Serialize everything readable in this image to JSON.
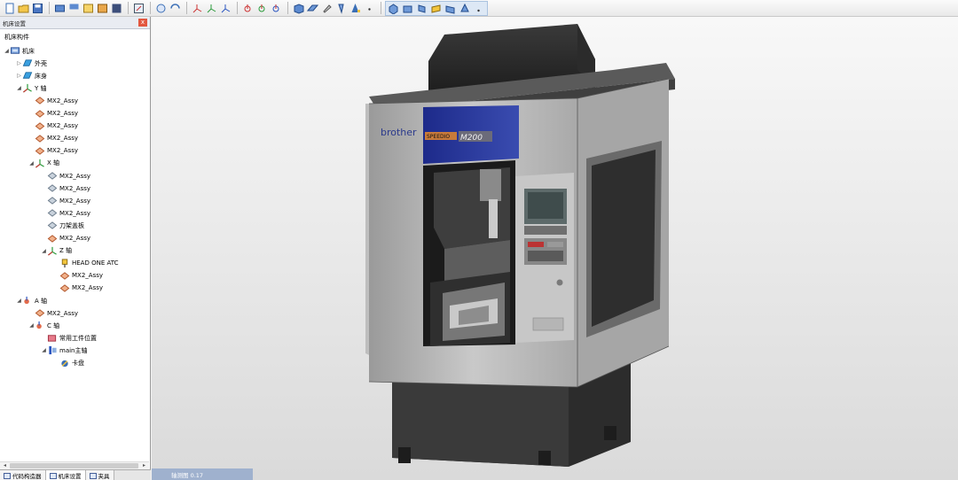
{
  "toolbar": {
    "buttons": [
      {
        "icon": "new-file-icon"
      },
      {
        "icon": "open-folder-icon"
      },
      {
        "icon": "save-icon"
      },
      {
        "sep": true
      },
      {
        "icon": "machine-view-icon"
      },
      {
        "icon": "scale-icon",
        "text": "1.00"
      },
      {
        "icon": "open-project-icon"
      },
      {
        "icon": "export-icon"
      },
      {
        "icon": "script-icon"
      },
      {
        "sep": true
      },
      {
        "icon": "settings-edit-icon"
      },
      {
        "sep": true
      },
      {
        "icon": "rotate-refresh-icon"
      },
      {
        "icon": "sync-icon"
      },
      {
        "sep": true
      },
      {
        "icon": "axis-x-icon"
      },
      {
        "icon": "axis-y-icon"
      },
      {
        "icon": "axis-z-icon"
      },
      {
        "sep": true
      },
      {
        "icon": "axis-rotate-a-icon"
      },
      {
        "icon": "axis-rotate-b-icon"
      },
      {
        "icon": "axis-rotate-c-icon"
      },
      {
        "sep": true
      },
      {
        "icon": "solid-cube-icon"
      },
      {
        "icon": "plane-icon"
      },
      {
        "icon": "paint-icon"
      },
      {
        "icon": "tool-icon"
      },
      {
        "icon": "cone-icon"
      },
      {
        "icon": "dot-menu-icon"
      },
      {
        "sep": true
      }
    ],
    "group_buttons": [
      {
        "icon": "view-iso-icon"
      },
      {
        "icon": "view-front-icon"
      },
      {
        "icon": "view-side-icon"
      },
      {
        "icon": "view-top-icon"
      },
      {
        "icon": "view-bottom-icon"
      },
      {
        "icon": "view-zoom-icon"
      },
      {
        "icon": "view-more-icon"
      }
    ]
  },
  "panel": {
    "title": "机床设置",
    "close_label": "x",
    "tree_header": "机床构件",
    "tree": [
      {
        "label": "机床",
        "depth": 0,
        "icon": "machine-icon",
        "twisty": "◢"
      },
      {
        "label": "外壳",
        "depth": 1,
        "icon": "shell-icon",
        "twisty": "▷"
      },
      {
        "label": "床身",
        "depth": 1,
        "icon": "shell-icon",
        "twisty": "▷"
      },
      {
        "label": "Y 轴",
        "depth": 1,
        "icon": "axis-icon",
        "twisty": "◢"
      },
      {
        "label": "MX2_Assy",
        "depth": 2,
        "icon": "part-orange-icon"
      },
      {
        "label": "MX2_Assy",
        "depth": 2,
        "icon": "part-orange-icon"
      },
      {
        "label": "MX2_Assy",
        "depth": 2,
        "icon": "part-orange-icon"
      },
      {
        "label": "MX2_Assy",
        "depth": 2,
        "icon": "part-orange-icon"
      },
      {
        "label": "MX2_Assy",
        "depth": 2,
        "icon": "part-orange-icon"
      },
      {
        "label": "X 轴",
        "depth": 2,
        "icon": "axis-icon",
        "twisty": "◢"
      },
      {
        "label": "MX2_Assy",
        "depth": 3,
        "icon": "part-gray-icon"
      },
      {
        "label": "MX2_Assy",
        "depth": 3,
        "icon": "part-gray-icon"
      },
      {
        "label": "MX2_Assy",
        "depth": 3,
        "icon": "part-gray-icon"
      },
      {
        "label": "MX2_Assy",
        "depth": 3,
        "icon": "part-gray-icon"
      },
      {
        "label": "刀架盖板",
        "depth": 3,
        "icon": "part-gray-icon"
      },
      {
        "label": "MX2_Assy",
        "depth": 3,
        "icon": "part-orange-icon"
      },
      {
        "label": "Z 轴",
        "depth": 3,
        "icon": "axis-icon",
        "twisty": "◢"
      },
      {
        "label": "HEAD ONE ATC",
        "depth": 4,
        "icon": "spindle-head-icon"
      },
      {
        "label": "MX2_Assy",
        "depth": 4,
        "icon": "part-orange-icon"
      },
      {
        "label": "MX2_Assy",
        "depth": 4,
        "icon": "part-orange-icon"
      },
      {
        "label": "A 轴",
        "depth": 1,
        "icon": "rotary-axis-icon",
        "twisty": "◢"
      },
      {
        "label": "MX2_Assy",
        "depth": 2,
        "icon": "part-orange-icon"
      },
      {
        "label": "C 轴",
        "depth": 2,
        "icon": "rotary-axis-icon",
        "twisty": "◢"
      },
      {
        "label": "常用工件位置",
        "depth": 3,
        "icon": "workpiece-icon"
      },
      {
        "label": "main主轴",
        "depth": 3,
        "icon": "spindle-icon",
        "twisty": "◢"
      },
      {
        "label": "卡盘",
        "depth": 4,
        "icon": "chuck-icon"
      }
    ],
    "bottom_tabs": [
      {
        "label": "代码构造器"
      },
      {
        "label": "机床设置",
        "active": true
      },
      {
        "label": "夹具"
      }
    ]
  },
  "viewport": {
    "machine_brand": "brother",
    "machine_series": "SPEEDIO",
    "machine_model": "M200",
    "status_label": "轴测图 0.17"
  }
}
